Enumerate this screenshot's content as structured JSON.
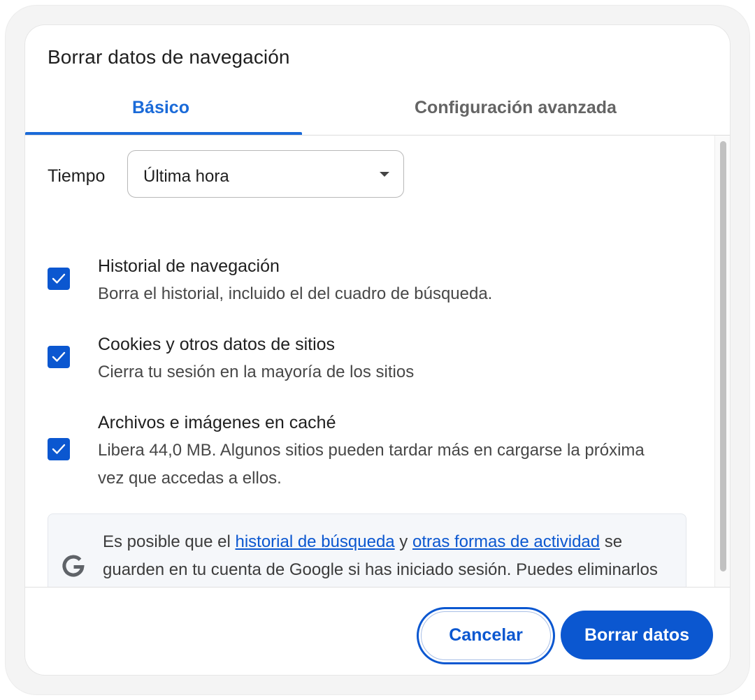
{
  "dialog": {
    "title": "Borrar datos de navegación"
  },
  "tabs": [
    {
      "label": "Básico",
      "active": true
    },
    {
      "label": "Configuración avanzada",
      "active": false
    }
  ],
  "time_range": {
    "label": "Tiempo",
    "selected": "Última hora"
  },
  "items": [
    {
      "title": "Historial de navegación",
      "description": "Borra el historial, incluido el del cuadro de búsqueda.",
      "checked": true
    },
    {
      "title": "Cookies y otros datos de sitios",
      "description": "Cierra tu sesión en la mayoría de los sitios",
      "checked": true
    },
    {
      "title": "Archivos e imágenes en caché",
      "description": "Libera 44,0 MB. Algunos sitios pueden tardar más en cargarse la próxima vez que accedas a ellos.",
      "checked": true
    }
  ],
  "info": {
    "icon": "google-g-icon",
    "text_before": "Es posible que el ",
    "link1": "historial de búsqueda",
    "text_middle": " y ",
    "link2": "otras formas de actividad",
    "text_after": " se guarden en tu cuenta de Google si has iniciado sesión. Puedes eliminarlos cuando quieras."
  },
  "buttons": {
    "cancel": "Cancelar",
    "delete": "Borrar datos"
  },
  "colors": {
    "accent": "#0b57d0",
    "tab_active": "#1a6ad8"
  }
}
